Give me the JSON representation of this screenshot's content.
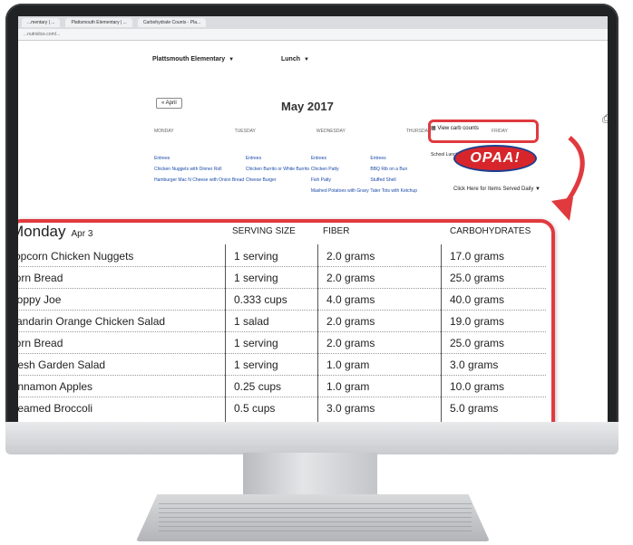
{
  "browser": {
    "tabs": [
      "...mentary | ...",
      "Plattsmouth Elementary | ...",
      "Carbohydrate Counts - Pla..."
    ],
    "address": "...nutrislice.com/..."
  },
  "site": {
    "school_select": "Plattsmouth Elementary",
    "meal_select": "Lunch",
    "month_title": "May 2017",
    "prev_month": "« April",
    "weekdays": [
      "MONDAY",
      "TUESDAY",
      "WEDNESDAY",
      "THURSDAY",
      "FRIDAY"
    ],
    "columns": [
      [
        "Entrees",
        "Chicken Nuggets with Dinner Roll",
        "Hamburger Mac N Cheese with Onion Bread"
      ],
      [
        "Entrees",
        "Chicken Burrito or White Burrito",
        "Cheese Burger"
      ],
      [
        "Entrees",
        "Chicken Patty",
        "Fish Patty",
        "Mashed Potatoes with Gravy"
      ],
      [
        "Entrees",
        "BBQ Rib on a Bun",
        "Stuffed Shell",
        "Tater Tots with Ketchup"
      ]
    ],
    "school_lunch_label": "School Lunch Here Day!",
    "view_carb_counts": "View carb counts",
    "opaa_logo": "OPAA!",
    "click_here": "Click Here for Items Served Daily",
    "icon_names": [
      "print-icon",
      "share-icon"
    ]
  },
  "menu_table": {
    "day": "Monday",
    "date": "Apr 3",
    "headers": [
      "SERVING SIZE",
      "FIBER",
      "CARBOHYDRATES"
    ],
    "rows": [
      {
        "item": "Popcorn Chicken Nuggets",
        "serving": "1 serving",
        "fiber": "2.0 grams",
        "carbs": "17.0 grams"
      },
      {
        "item": "Corn Bread",
        "serving": "1 serving",
        "fiber": "2.0 grams",
        "carbs": "25.0 grams"
      },
      {
        "item": "Sloppy Joe",
        "serving": "0.333 cups",
        "fiber": "4.0 grams",
        "carbs": "40.0 grams"
      },
      {
        "item": "Mandarin Orange Chicken Salad",
        "serving": "1 salad",
        "fiber": "2.0 grams",
        "carbs": "19.0 grams"
      },
      {
        "item": "Corn Bread",
        "serving": "1 serving",
        "fiber": "2.0 grams",
        "carbs": "25.0 grams"
      },
      {
        "item": "Fresh Garden Salad",
        "serving": "1 serving",
        "fiber": "1.0 gram",
        "carbs": "3.0 grams"
      },
      {
        "item": "Cinnamon Apples",
        "serving": "0.25 cups",
        "fiber": "1.0 gram",
        "carbs": "10.0 grams"
      },
      {
        "item": "Steamed Broccoli",
        "serving": "0.5 cups",
        "fiber": "3.0 grams",
        "carbs": "5.0 grams"
      }
    ]
  },
  "colors": {
    "accent": "#e03a3e",
    "logo_red": "#d7262b",
    "logo_blue": "#1c3f8f",
    "bezel": "#202224"
  }
}
